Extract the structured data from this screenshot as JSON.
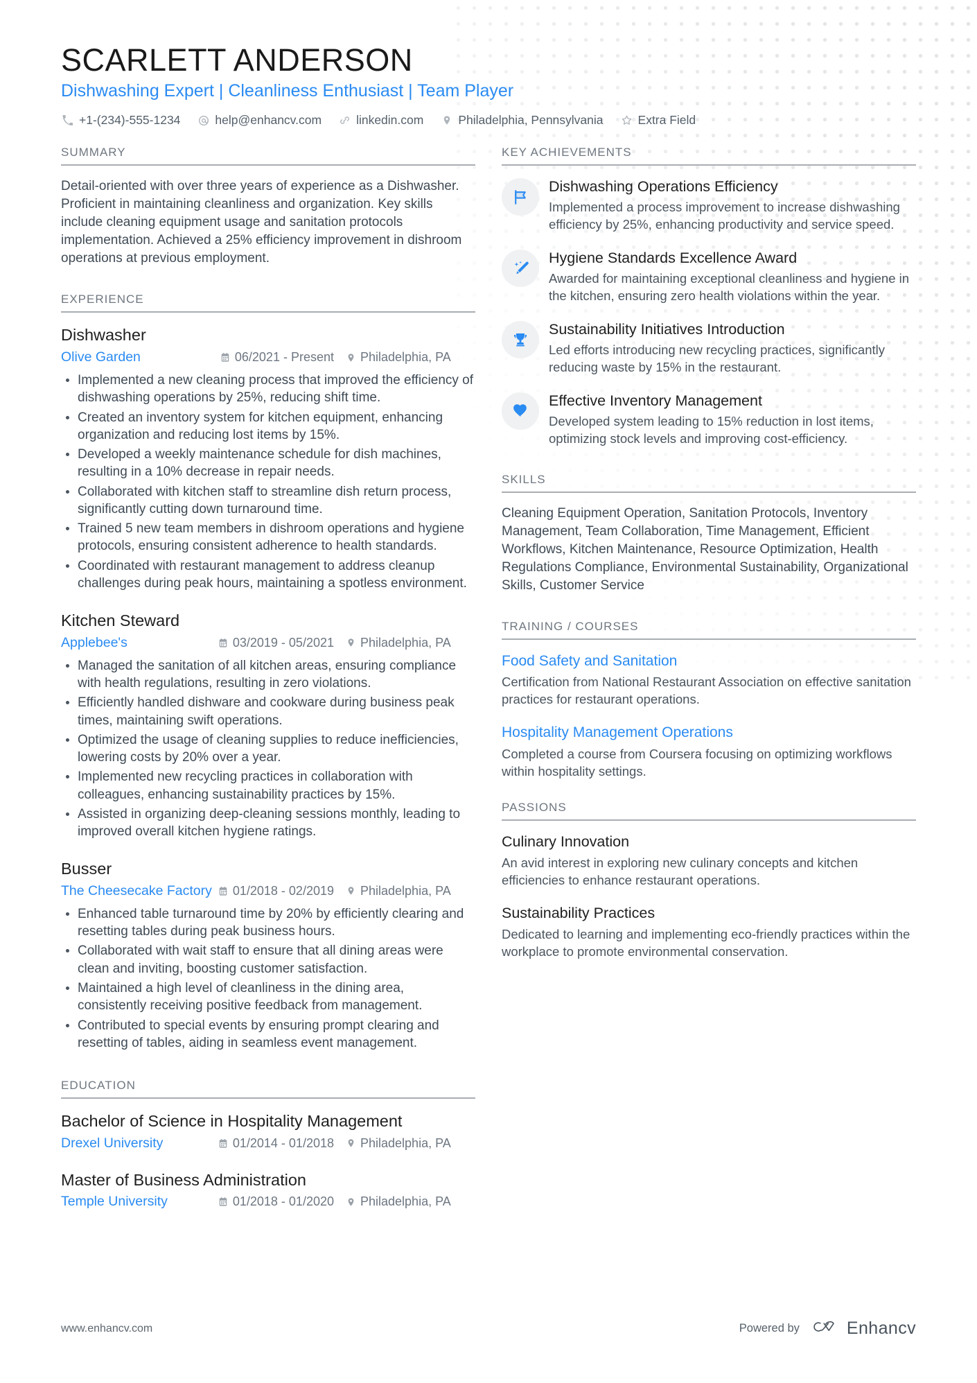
{
  "header": {
    "name": "SCARLETT ANDERSON",
    "headline": "Dishwashing Expert | Cleanliness Enthusiast | Team Player",
    "contacts": [
      {
        "icon": "phone-icon",
        "value": "+1-(234)-555-1234"
      },
      {
        "icon": "email-icon",
        "value": "help@enhancv.com"
      },
      {
        "icon": "link-icon",
        "value": "linkedin.com"
      },
      {
        "icon": "location-icon",
        "value": "Philadelphia, Pennsylvania"
      },
      {
        "icon": "star-icon",
        "value": "Extra Field"
      }
    ]
  },
  "sections": {
    "summary": {
      "title": "SUMMARY",
      "text": "Detail-oriented with over three years of experience as a Dishwasher. Proficient in maintaining cleanliness and organization. Key skills include cleaning equipment usage and sanitation protocols implementation. Achieved a 25% efficiency improvement in dishroom operations at previous employment."
    },
    "experience": {
      "title": "EXPERIENCE",
      "entries": [
        {
          "role": "Dishwasher",
          "org": "Olive Garden",
          "date": "06/2021 - Present",
          "location": "Philadelphia, PA",
          "bullets": [
            "Implemented a new cleaning process that improved the efficiency of dishwashing operations by 25%, reducing shift time.",
            "Created an inventory system for kitchen equipment, enhancing organization and reducing lost items by 15%.",
            "Developed a weekly maintenance schedule for dish machines, resulting in a 10% decrease in repair needs.",
            "Collaborated with kitchen staff to streamline dish return process, significantly cutting down turnaround time.",
            "Trained 5 new team members in dishroom operations and hygiene protocols, ensuring consistent adherence to health standards.",
            "Coordinated with restaurant management to address cleanup challenges during peak hours, maintaining a spotless environment."
          ]
        },
        {
          "role": "Kitchen Steward",
          "org": "Applebee's",
          "date": "03/2019 - 05/2021",
          "location": "Philadelphia, PA",
          "bullets": [
            "Managed the sanitation of all kitchen areas, ensuring compliance with health regulations, resulting in zero violations.",
            "Efficiently handled dishware and cookware during business peak times, maintaining swift operations.",
            "Optimized the usage of cleaning supplies to reduce inefficiencies, lowering costs by 20% over a year.",
            "Implemented new recycling practices in collaboration with colleagues, enhancing sustainability practices by 15%.",
            "Assisted in organizing deep-cleaning sessions monthly, leading to improved overall kitchen hygiene ratings."
          ]
        },
        {
          "role": "Busser",
          "org": "The Cheesecake Factory",
          "date": "01/2018 - 02/2019",
          "location": "Philadelphia, PA",
          "bullets": [
            "Enhanced table turnaround time by 20% by efficiently clearing and resetting tables during peak business hours.",
            "Collaborated with wait staff to ensure that all dining areas were clean and inviting, boosting customer satisfaction.",
            "Maintained a high level of cleanliness in the dining area, consistently receiving positive feedback from management.",
            "Contributed to special events by ensuring prompt clearing and resetting of tables, aiding in seamless event management."
          ]
        }
      ]
    },
    "education": {
      "title": "EDUCATION",
      "entries": [
        {
          "degree": "Bachelor of Science in Hospitality Management",
          "school": "Drexel University",
          "date": "01/2014 - 01/2018",
          "location": "Philadelphia, PA"
        },
        {
          "degree": "Master of Business Administration",
          "school": "Temple University",
          "date": "01/2018 - 01/2020",
          "location": "Philadelphia, PA"
        }
      ]
    },
    "key_achievements": {
      "title": "KEY ACHIEVEMENTS",
      "items": [
        {
          "icon": "flag-icon",
          "title": "Dishwashing Operations Efficiency",
          "desc": "Implemented a process improvement to increase dishwashing efficiency by 25%, enhancing productivity and service speed."
        },
        {
          "icon": "magic-wand-icon",
          "title": "Hygiene Standards Excellence Award",
          "desc": "Awarded for maintaining exceptional cleanliness and hygiene in the kitchen, ensuring zero health violations within the year."
        },
        {
          "icon": "trophy-icon",
          "title": "Sustainability Initiatives Introduction",
          "desc": "Led efforts introducing new recycling practices, significantly reducing waste by 15% in the restaurant."
        },
        {
          "icon": "heart-icon",
          "title": "Effective Inventory Management",
          "desc": "Developed system leading to 15% reduction in lost items, optimizing stock levels and improving cost-efficiency."
        }
      ]
    },
    "skills": {
      "title": "SKILLS",
      "text": "Cleaning Equipment Operation, Sanitation Protocols, Inventory Management, Team Collaboration, Time Management, Efficient Workflows, Kitchen Maintenance, Resource Optimization, Health Regulations Compliance, Environmental Sustainability, Organizational Skills, Customer Service"
    },
    "training": {
      "title": "TRAINING / COURSES",
      "items": [
        {
          "title": "Food Safety and Sanitation",
          "desc": "Certification from National Restaurant Association on effective sanitation practices for restaurant operations."
        },
        {
          "title": "Hospitality Management Operations",
          "desc": "Completed a course from Coursera focusing on optimizing workflows within hospitality settings."
        }
      ]
    },
    "passions": {
      "title": "PASSIONS",
      "items": [
        {
          "title": "Culinary Innovation",
          "desc": "An avid interest in exploring new culinary concepts and kitchen efficiencies to enhance restaurant operations."
        },
        {
          "title": "Sustainability Practices",
          "desc": "Dedicated to learning and implementing eco-friendly practices within the workplace to promote environmental conservation."
        }
      ]
    }
  },
  "footer": {
    "url": "www.enhancv.com",
    "powered_by": "Powered by",
    "brand": "Enhancv"
  },
  "colors": {
    "accent": "#2a8bf2",
    "text": "#3f4a55",
    "muted": "#6f7780",
    "rule": "#a9adb2",
    "badge_bg": "#f0f1f2"
  }
}
